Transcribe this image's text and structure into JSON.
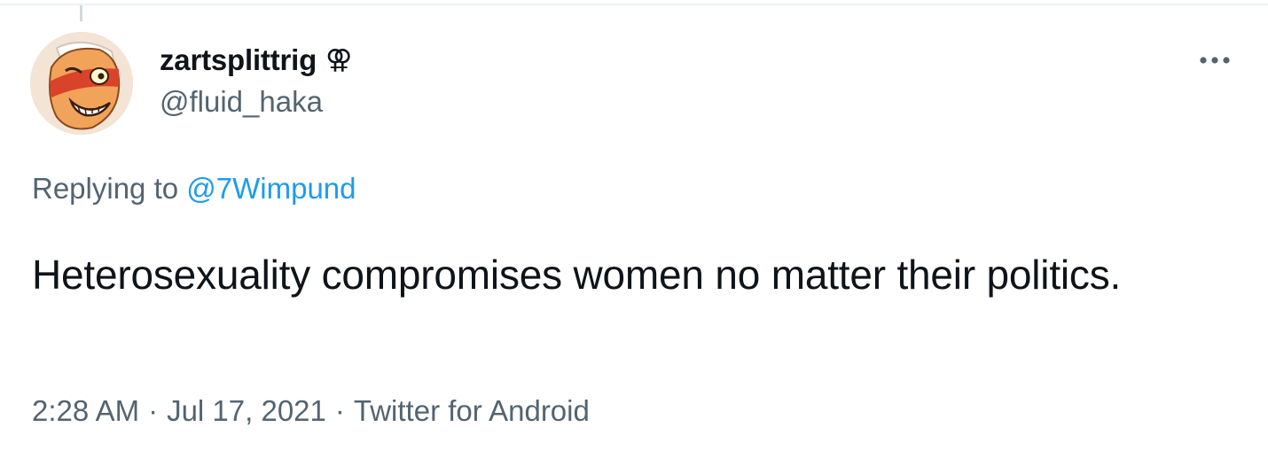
{
  "tweet": {
    "author": {
      "display_name": "zartsplittrig",
      "name_symbol": "⚢",
      "handle": "@fluid_haka",
      "avatar_icon": "cartoon-face-avatar"
    },
    "more_icon": "more-horizontal-icon",
    "replying_prefix": "Replying to",
    "replying_to": "@7Wimpund",
    "text": "Heterosexuality compromises women no matter their politics.",
    "time": "2:28 AM",
    "separator": "·",
    "date": "Jul 17, 2021",
    "source": "Twitter for Android"
  },
  "colors": {
    "text_primary": "#0f1419",
    "text_secondary": "#536471",
    "link": "#1d9bf0"
  }
}
